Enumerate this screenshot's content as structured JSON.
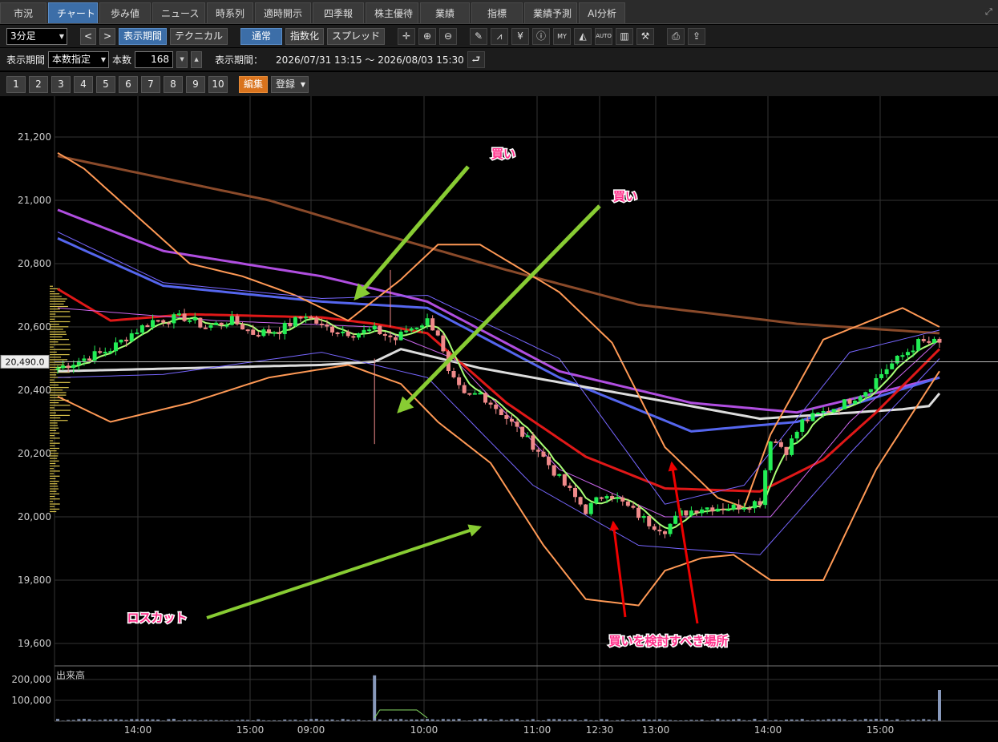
{
  "tabs": [
    "市況",
    "チャート",
    "歩み値",
    "ニュース",
    "時系列",
    "適時開示",
    "四季報",
    "株主優待",
    "業績",
    "指標",
    "業績予測",
    "AI分析"
  ],
  "active_tab": 1,
  "toolbar1": {
    "interval": "3分足",
    "prev": "<",
    "next": ">",
    "period_button": "表示期間",
    "technical_button": "テクニカル",
    "normal_button": "通常",
    "index_button": "指数化",
    "spread_button": "スプレッド"
  },
  "toolbar2": {
    "period_label": "表示期間",
    "count_mode": "本数指定",
    "count_label": "本数",
    "count_value": "168",
    "range_label": "表示期間：",
    "range_value": "2026/07/31 13:15 ～ 2026/08/03 15:30"
  },
  "toolbar3": {
    "presets": [
      "1",
      "2",
      "3",
      "4",
      "5",
      "6",
      "7",
      "8",
      "9",
      "10"
    ],
    "edit_button": "編集",
    "register_button": "登録"
  },
  "icons": [
    "crosshair-icon",
    "zoom-in-icon",
    "zoom-out-icon",
    "pencil-icon",
    "chart-type-icon",
    "yen-icon",
    "info-icon",
    "my-icon",
    "area-chart-icon",
    "auto-icon",
    "indicator-icon",
    "wrench-icon",
    "print-icon",
    "export-icon"
  ],
  "colors": {
    "up_candle": "#22ee55",
    "down_candle": "#f08a8a",
    "sma_short": "#aaff77",
    "sma_red": "#e01818",
    "sma_blue": "#5566ee",
    "sma_purple": "#b04ee0",
    "sma_brown": "#8a4a2a",
    "vwap_white": "#dddddd",
    "bollinger_orange": "#ff9955",
    "arrow_green": "#88cc33",
    "arrow_red": "#ee0000",
    "annotation": "#ff2f8a"
  },
  "chart_data": {
    "type": "candlestick",
    "ylim": [
      19580,
      21230
    ],
    "y_ticks": [
      "21,200",
      "21,000",
      "20,800",
      "20,600",
      "20,400",
      "20,200",
      "20,000",
      "19,800",
      "19,600"
    ],
    "y_tick_values": [
      21200,
      21000,
      20800,
      20600,
      20400,
      20200,
      20000,
      19800,
      19600
    ],
    "x_ticks": [
      "14:00",
      "15:00",
      "09:00",
      "10:00",
      "11:00",
      "12:30",
      "13:00",
      "14:00",
      "15:00"
    ],
    "current_price_label": "20,490.0",
    "current_price": 20490,
    "volume_label": "出来高",
    "volume_ticks": [
      "200,000",
      "100,000"
    ],
    "volume_tick_values": [
      200000,
      100000
    ],
    "annotations": [
      {
        "text": "買い",
        "price": 21110
      },
      {
        "text": "買い",
        "price": 20990
      },
      {
        "text": "ロスカット",
        "price": 19740
      },
      {
        "text": "買いを検討すべき場所",
        "price": 19605
      }
    ]
  }
}
